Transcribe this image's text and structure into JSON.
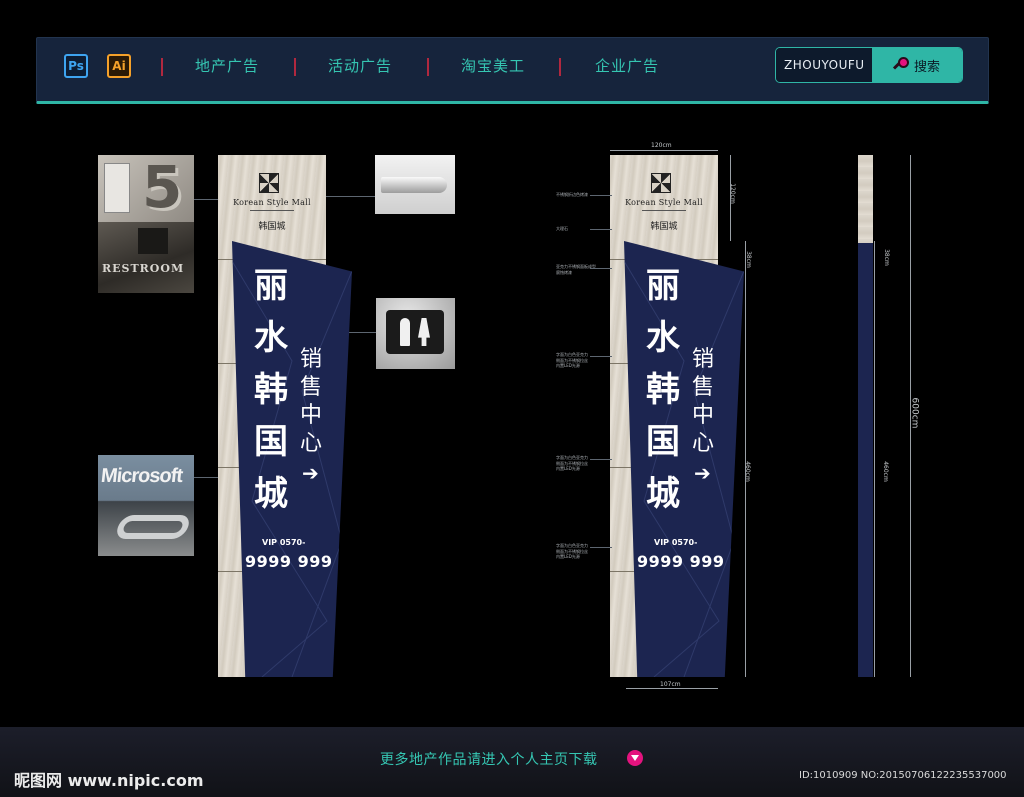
{
  "nav": {
    "ps_label": "Ps",
    "ai_label": "Ai",
    "items": [
      "地产广告",
      "活动广告",
      "淘宝美工",
      "企业广告"
    ],
    "search_value": "ZHOUYOUFU",
    "search_button": "搜索"
  },
  "sign": {
    "mall_en": "Korean Style Mall",
    "mall_cn": "韩国城",
    "chars": [
      "丽",
      "水",
      "韩",
      "国",
      "城"
    ],
    "sub_chars": [
      "销",
      "售",
      "中",
      "心"
    ],
    "arrow": "➔",
    "vip": "VIP 0570-",
    "phone": "9999 999"
  },
  "photos": {
    "plate_number": "5",
    "restroom_text": "RESTROOM",
    "microsoft_text": "Microsoft"
  },
  "dimensions": {
    "width_top": "120cm",
    "width_bottom": "107cm",
    "height_top": "120cm",
    "seg_top": "38cm",
    "seg_main": "460cm",
    "total": "600cm",
    "side_top": "38cm",
    "side_main": "460cm"
  },
  "notes": [
    "不锈钢折边色烤漆",
    "大理石",
    "亚克力不锈钢面板成型\n腐蚀烤漆",
    "字面为白色亚克力\n侧面为不锈钢拉丝\n内置LED光源",
    "字面为白色亚克力\n侧面为不锈钢拉丝\n内置LED光源",
    "字面为白色亚克力\n侧面为不锈钢拉丝\n内置LED光源"
  ],
  "footer": {
    "link": "更多地产作品请进入个人主页下载",
    "watermark_left": "昵图网 www.nipic.com",
    "watermark_right": "ID:1010909 NO:20150706122235537000"
  }
}
